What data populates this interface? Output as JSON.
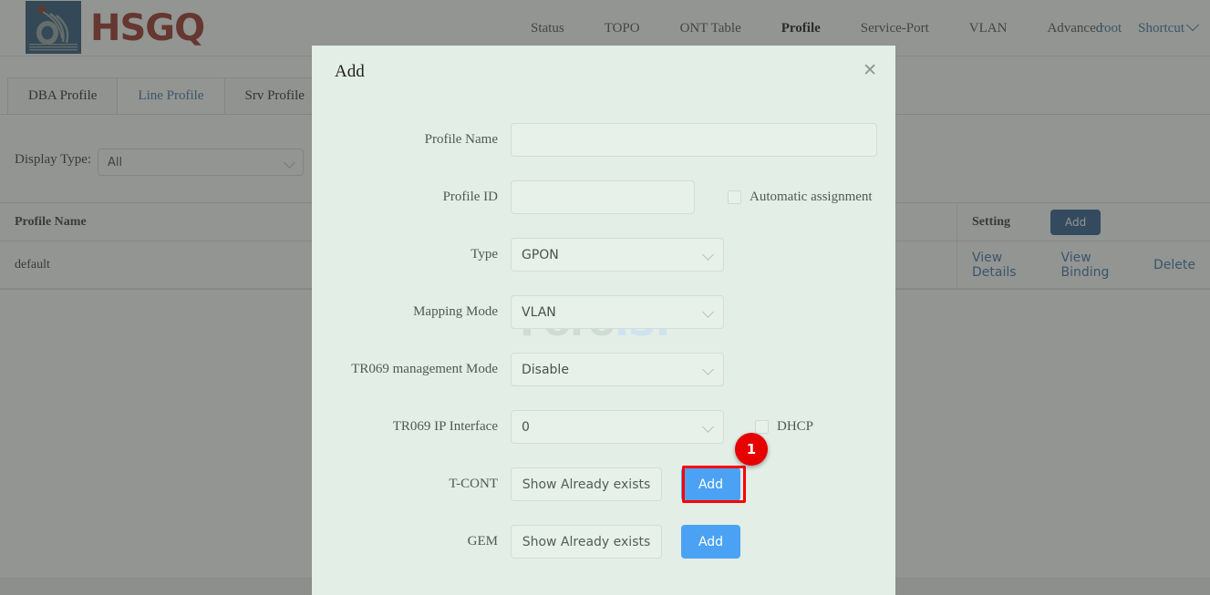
{
  "brand": {
    "name": "HSGQ",
    "logo_blue": "#2b5279",
    "logo_red": "#9a2a20"
  },
  "nav": {
    "items": [
      {
        "label": "Status",
        "active": false
      },
      {
        "label": "TOPO",
        "active": false
      },
      {
        "label": "ONT Table",
        "active": false
      },
      {
        "label": "Profile",
        "active": true
      },
      {
        "label": "Service-Port",
        "active": false
      },
      {
        "label": "VLAN",
        "active": false
      },
      {
        "label": "Advanced",
        "active": false
      }
    ],
    "user": "root",
    "shortcut": "Shortcut",
    "shortcut_icon": "chevron-down-icon"
  },
  "tabs": [
    {
      "label": "DBA Profile",
      "active": false
    },
    {
      "label": "Line Profile",
      "active": true
    },
    {
      "label": "Srv Profile",
      "active": false
    }
  ],
  "filter": {
    "label": "Display Type:",
    "value": "All",
    "icon": "chevron-down-icon"
  },
  "table": {
    "headers": [
      "Profile Name",
      "",
      "",
      "Setting"
    ],
    "add_label": "Add",
    "rows": [
      {
        "profile_name": "default",
        "actions": [
          "View Details",
          "View Binding",
          "Delete"
        ]
      }
    ]
  },
  "modal": {
    "title": "Add",
    "close_icon": "close-icon",
    "background": "#e2eee6",
    "fields": {
      "profile_name": {
        "label": "Profile Name",
        "value": "",
        "placeholder": ""
      },
      "profile_id": {
        "label": "Profile ID",
        "value": "",
        "placeholder": ""
      },
      "automatic_assignment": {
        "label": "Automatic assignment",
        "checked": false
      },
      "type": {
        "label": "Type",
        "value": "GPON",
        "icon": "chevron-down-icon"
      },
      "mapping_mode": {
        "label": "Mapping Mode",
        "value": "VLAN",
        "icon": "chevron-down-icon"
      },
      "tr069_management_mode": {
        "label": "TR069 management Mode",
        "value": "Disable",
        "icon": "chevron-down-icon"
      },
      "tr069_ip_interface": {
        "label": "TR069 IP Interface",
        "value": "0",
        "icon": "chevron-down-icon"
      },
      "dhcp": {
        "label": "DHCP",
        "checked": false
      },
      "tcont": {
        "label": "T-CONT",
        "show_label": "Show Already exists",
        "add_label": "Add"
      },
      "gem": {
        "label": "GEM",
        "show_label": "Show Already exists",
        "add_label": "Add"
      }
    }
  },
  "watermark": {
    "part1": "Foro",
    "part2": "ISP",
    "color1": "#cfdcd3",
    "color2": "#cfe2ef"
  },
  "highlight": {
    "badge_number": "1",
    "badge_color": "#e60000",
    "border_color": "#ff0000",
    "target": "tcont-add-button"
  }
}
